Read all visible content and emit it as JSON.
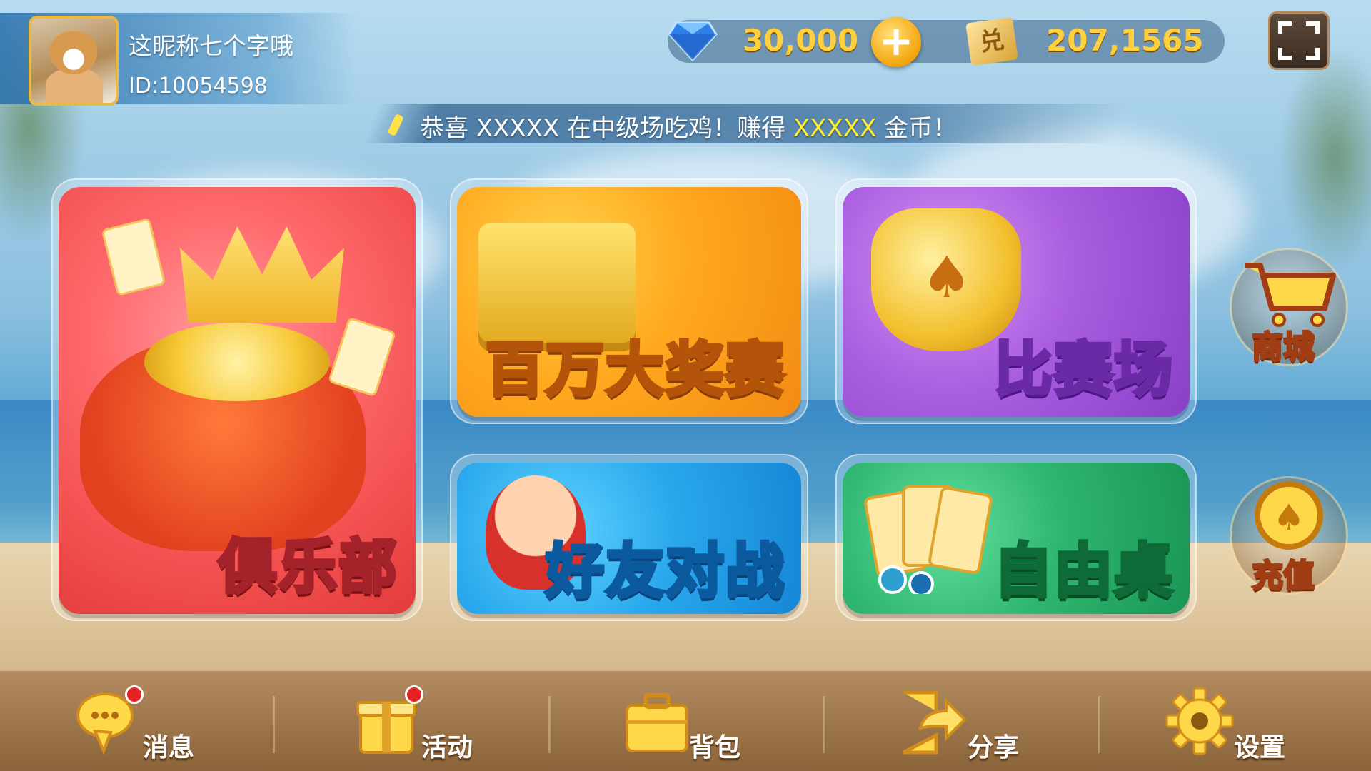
{
  "profile": {
    "nickname": "这昵称七个字哦",
    "user_id": "ID:10054598"
  },
  "currency": {
    "diamonds": "30,000",
    "add_label": "+",
    "exchange_label": "兑",
    "coins": "207,1565"
  },
  "broadcast": {
    "prefix": "恭喜 XXXXX 在中级场吃鸡！赚得 ",
    "highlight": "XXXXX",
    "suffix": " 金币！"
  },
  "modes": {
    "club": "俱乐部",
    "million": "百万大奖赛",
    "arena": "比赛场",
    "friends": "好友对战",
    "free_table": "自由桌"
  },
  "side": {
    "shop": "商城",
    "recharge": "充值"
  },
  "nav": [
    {
      "label": "消息",
      "icon": "chat-bubble-icon",
      "badge": true
    },
    {
      "label": "活动",
      "icon": "gift-icon",
      "badge": true
    },
    {
      "label": "背包",
      "icon": "briefcase-icon",
      "badge": false
    },
    {
      "label": "分享",
      "icon": "share-icon",
      "badge": false
    },
    {
      "label": "设置",
      "icon": "gear-icon",
      "badge": false
    }
  ],
  "colors": {
    "currency_text": "#ffcf3d",
    "highlight": "#ffee35",
    "club": "#f24f4f",
    "million": "#ffa81e",
    "arena": "#a95de0",
    "friends": "#2aa8ec",
    "free_table": "#2eb56f"
  }
}
